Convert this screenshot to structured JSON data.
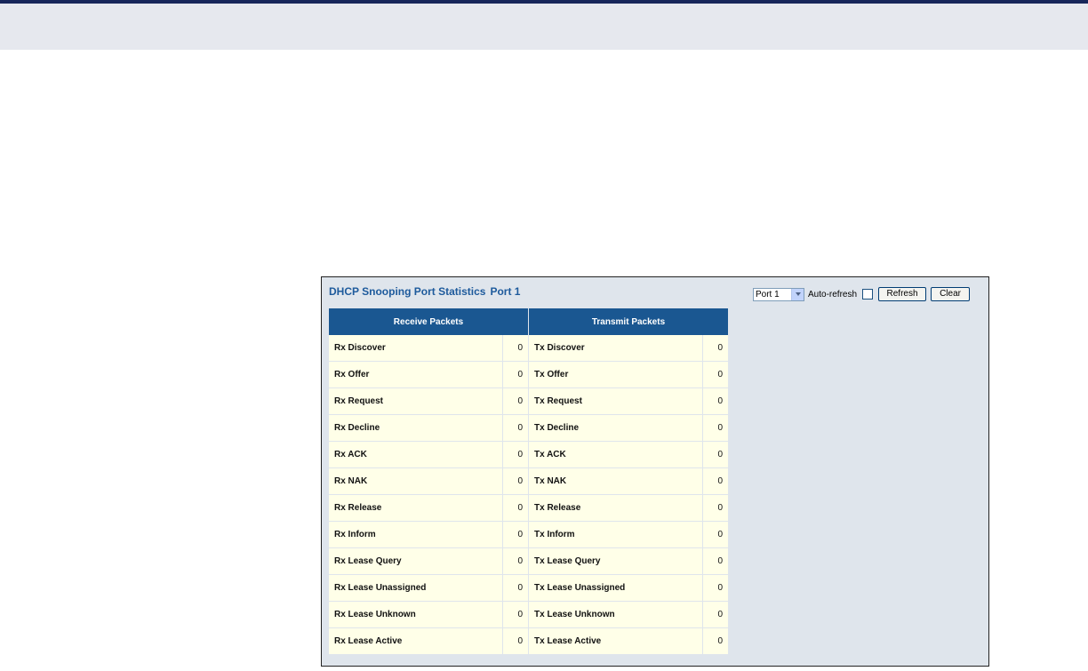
{
  "panel": {
    "title_main": "DHCP Snooping Port Statistics",
    "title_port": "Port 1"
  },
  "controls": {
    "port_select_value": "Port 1",
    "auto_refresh_label": "Auto-refresh",
    "auto_refresh_checked": false,
    "refresh_label": "Refresh",
    "clear_label": "Clear"
  },
  "table": {
    "headers": [
      "Receive Packets",
      "Transmit Packets"
    ],
    "rows": [
      {
        "rx_name": "Rx Discover",
        "rx_value": "0",
        "tx_name": "Tx Discover",
        "tx_value": "0"
      },
      {
        "rx_name": "Rx Offer",
        "rx_value": "0",
        "tx_name": "Tx Offer",
        "tx_value": "0"
      },
      {
        "rx_name": "Rx Request",
        "rx_value": "0",
        "tx_name": "Tx Request",
        "tx_value": "0"
      },
      {
        "rx_name": "Rx Decline",
        "rx_value": "0",
        "tx_name": "Tx Decline",
        "tx_value": "0"
      },
      {
        "rx_name": "Rx ACK",
        "rx_value": "0",
        "tx_name": "Tx ACK",
        "tx_value": "0"
      },
      {
        "rx_name": "Rx NAK",
        "rx_value": "0",
        "tx_name": "Tx NAK",
        "tx_value": "0"
      },
      {
        "rx_name": "Rx Release",
        "rx_value": "0",
        "tx_name": "Tx Release",
        "tx_value": "0"
      },
      {
        "rx_name": "Rx Inform",
        "rx_value": "0",
        "tx_name": "Tx Inform",
        "tx_value": "0"
      },
      {
        "rx_name": "Rx Lease Query",
        "rx_value": "0",
        "tx_name": "Tx Lease Query",
        "tx_value": "0"
      },
      {
        "rx_name": "Rx Lease Unassigned",
        "rx_value": "0",
        "tx_name": "Tx Lease Unassigned",
        "tx_value": "0"
      },
      {
        "rx_name": "Rx Lease Unknown",
        "rx_value": "0",
        "tx_name": "Tx Lease Unknown",
        "tx_value": "0"
      },
      {
        "rx_name": "Rx Lease Active",
        "rx_value": "0",
        "tx_name": "Tx Lease Active",
        "tx_value": "0"
      }
    ]
  },
  "colors": {
    "header_bg": "#1a5791",
    "title_text": "#1d5a9c",
    "row_bg": "#ffffe8",
    "panel_bg": "#dfe5ec"
  }
}
